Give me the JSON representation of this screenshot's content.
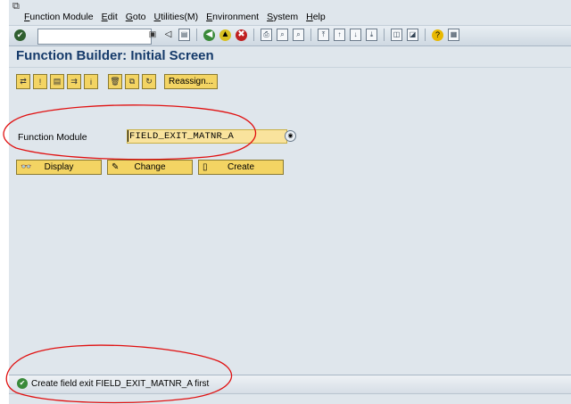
{
  "menubar": {
    "items": [
      "Function Module",
      "Edit",
      "Goto",
      "Utilities(M)",
      "Environment",
      "System",
      "Help"
    ]
  },
  "toolbar": {
    "command_field_value": "",
    "icons": [
      "enter-icon",
      "back-icon",
      "exit-icon",
      "cancel-icon",
      "print-icon",
      "find-icon",
      "find-next-icon",
      "first-page-icon",
      "previous-page-icon",
      "next-page-icon",
      "last-page-icon",
      "create-session-icon",
      "shortcut-icon",
      "help-icon",
      "customize-layout-icon"
    ]
  },
  "page": {
    "title": "Function Builder: Initial Screen"
  },
  "app_toolbar": {
    "reassign_label": "Reassign..."
  },
  "form": {
    "function_module_label": "Function Module",
    "function_module_value": "FIELD_EXIT_MATNR_A"
  },
  "actions": {
    "display_label": "Display",
    "change_label": "Change",
    "create_label": "Create"
  },
  "status": {
    "message": "Create field exit FIELD_EXIT_MATNR_A first"
  },
  "colors": {
    "title": "#153a6a",
    "background": "#dfe6ec",
    "button_fill": "#f3d463",
    "input_fill": "#f9e39d",
    "annotation": "#e01010"
  }
}
